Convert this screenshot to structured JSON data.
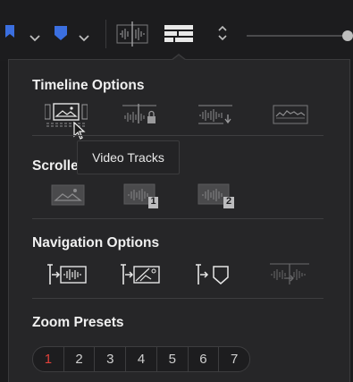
{
  "toolbar": {
    "icons": [
      "flag-icon",
      "chevron-down-icon",
      "marker-icon",
      "chevron-down-icon",
      "audio-waveform-icon",
      "timeline-view-icon",
      "updown-chevron-icon",
      "zoom-slider"
    ]
  },
  "timeline_options": {
    "title": "Timeline Options",
    "items": [
      "video-tracks-icon",
      "audio-lock-icon",
      "audio-waveform-down-icon",
      "waveform-overview-icon"
    ]
  },
  "tooltip": {
    "text": "Video Tracks"
  },
  "scroller": {
    "title": "Scroller",
    "items": [
      "scroller-video-icon",
      "scroller-audio-1-icon",
      "scroller-audio-2-icon"
    ],
    "badges": [
      "1",
      "2"
    ]
  },
  "navigation_options": {
    "title": "Navigation Options",
    "items": [
      "nav-audio-icon",
      "nav-video-icon",
      "nav-marker-icon",
      "nav-waveform-icon"
    ]
  },
  "zoom_presets": {
    "title": "Zoom Presets",
    "buttons": [
      "1",
      "2",
      "3",
      "4",
      "5",
      "6",
      "7"
    ],
    "active": "1"
  },
  "colors": {
    "accent": "#e0403a",
    "flag": "#3b6fe0",
    "panel": "#262628"
  }
}
